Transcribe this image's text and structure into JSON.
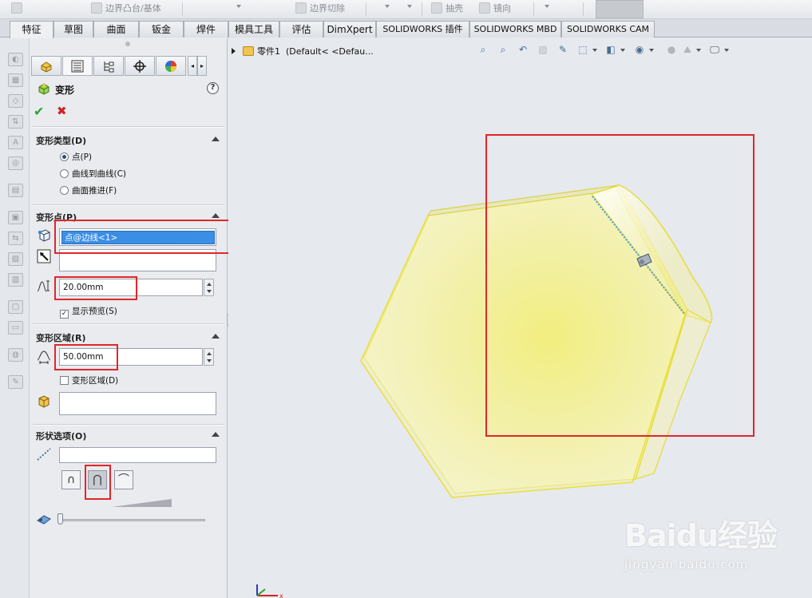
{
  "command_manager": {
    "items": [
      {
        "label": "边界凸台/基体"
      },
      {
        "label": "边界切除"
      },
      {
        "label": "抽壳"
      },
      {
        "label": "镜向"
      }
    ]
  },
  "tabs": [
    {
      "label": "特征",
      "active": true
    },
    {
      "label": "草图"
    },
    {
      "label": "曲面"
    },
    {
      "label": "钣金"
    },
    {
      "label": "焊件"
    },
    {
      "label": "模具工具"
    },
    {
      "label": "评估"
    },
    {
      "label": "DimXpert"
    },
    {
      "label": "SOLIDWORKS 插件"
    },
    {
      "label": "SOLIDWORKS MBD"
    },
    {
      "label": "SOLIDWORKS CAM"
    }
  ],
  "property_manager": {
    "title": "变形",
    "help": "?",
    "deform_type": {
      "title": "变形类型(D)",
      "options": [
        {
          "label": "点(P)",
          "selected": true
        },
        {
          "label": "曲线到曲线(C)",
          "selected": false
        },
        {
          "label": "曲面推进(F)",
          "selected": false
        }
      ]
    },
    "deform_point": {
      "title": "变形点(P)",
      "selection": "点@边线<1>",
      "direction_value": "",
      "distance": "20.00mm",
      "show_preview_label": "显示预览(S)",
      "show_preview_checked": true
    },
    "deform_region": {
      "title": "变形区域(R)",
      "radius": "50.00mm",
      "deform_region_label": "变形区域(D)",
      "deform_region_checked": false,
      "fixed_bodies_value": ""
    },
    "shape_options": {
      "title": "形状选项(O)",
      "axis_value": "",
      "selected_shape": 1,
      "stiffness_level": 0.0
    }
  },
  "graphics": {
    "tree_part_name": "零件1",
    "tree_config": "(Default< <Defau..."
  },
  "watermark": {
    "brand": "Baidu经验",
    "url": "jingyan.baidu.com"
  },
  "colors": {
    "accent_selection": "#3a8ee6",
    "annotation_red": "#e2262b",
    "model_yellow": "#f3ef8a",
    "ok_green": "#2aa236",
    "cancel_red": "#d42020"
  }
}
